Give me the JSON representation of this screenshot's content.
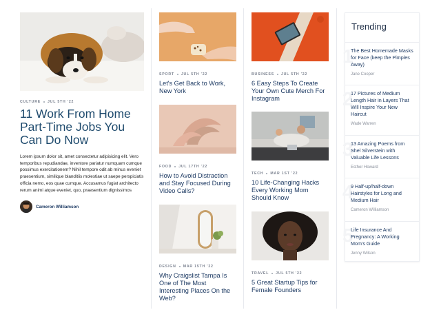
{
  "featured": {
    "category": "CULTURE",
    "date": "JUL 5TH '22",
    "title": "11 Work From Home Part-Time Jobs You Can Do Now",
    "excerpt": "Lorem ipsum dolor sit, amet consectetur adipisicing elit. Vero temporibus repudiandae, inventore pariatur numquam cumque possimus exercitationem? Nihil tempore odit ab minus eveniet praesentium, similique blanditiis molestiae ut saepe perspiciatis officia nemo, eos quae cumque. Accusamus fugiat architecto rerum animi atque eveniet, quo, praesentium dignissimos",
    "author": "Cameron Williamson"
  },
  "column2": [
    {
      "category": "SPORT",
      "date": "JUL 5TH '22",
      "title": "Let's Get Back to Work, New York"
    },
    {
      "category": "FOOD",
      "date": "JUL 17TH '22",
      "title": "How to Avoid Distraction and Stay Focused During Video Calls?"
    },
    {
      "category": "DESIGN",
      "date": "MAR 15TH '22",
      "title": "Why Craigslist Tampa Is One of The Most Interesting Places On the Web?"
    }
  ],
  "column3": [
    {
      "category": "BUSINESS",
      "date": "JUL 5TH '22",
      "title": "6 Easy Steps To Create Your Own Cute Merch For Instagram"
    },
    {
      "category": "TECH",
      "date": "MAR 1ST '22",
      "title": "10 Life-Changing Hacks Every Working Mom Should Know"
    },
    {
      "category": "TRAVEL",
      "date": "JUL 5TH '22",
      "title": "5 Great Startup Tips for Female Founders"
    }
  ],
  "trending": {
    "heading": "Trending",
    "items": [
      {
        "num": "1",
        "title": "The Best Homemade Masks for Face (keep the Pimples Away)",
        "author": "Jane Cooper"
      },
      {
        "num": "2",
        "title": "17 Pictures of Medium Length Hair in Layers That Will Inspire Your New Haircut",
        "author": "Wade Warren"
      },
      {
        "num": "3",
        "title": "13 Amazing Poems from Shel Silverstein with Valuable Life Lessons",
        "author": "Esther Howard"
      },
      {
        "num": "4",
        "title": "9 Half-up/half-down Hairstyles for Long and Medium Hair",
        "author": "Cameron Williamson"
      },
      {
        "num": "5",
        "title": "Life Insurance And Pregnancy: A Working Mom's Guide",
        "author": "Jenny Wilson"
      }
    ]
  },
  "colors": {
    "title": "#1d3a63",
    "meta": "#7b8290",
    "divider": "#e7e9ee"
  }
}
